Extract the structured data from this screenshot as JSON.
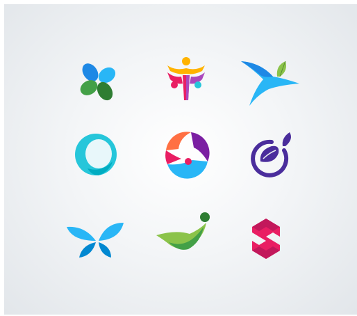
{
  "logos": [
    {
      "name": "clover-propeller-logo",
      "colors": [
        "#1e88e5",
        "#29b6f6",
        "#43a047",
        "#2e7d32"
      ]
    },
    {
      "name": "people-group-logo",
      "colors": [
        "#ffb300",
        "#e91e63",
        "#26c6da",
        "#ab47bc"
      ]
    },
    {
      "name": "bird-leaf-logo",
      "colors": [
        "#1e88e5",
        "#4fc3f7",
        "#8bc34a"
      ]
    },
    {
      "name": "ring-logo",
      "colors": [
        "#26c6da",
        "#00acc1",
        "#80deea"
      ]
    },
    {
      "name": "circle-people-logo",
      "colors": [
        "#ff7043",
        "#7b1fa2",
        "#e91e63",
        "#29b6f6"
      ]
    },
    {
      "name": "seed-leaf-ring-logo",
      "colors": [
        "#4a2d9c",
        "#6a5acd"
      ]
    },
    {
      "name": "butterfly-logo",
      "colors": [
        "#29b6f6",
        "#0288d1"
      ]
    },
    {
      "name": "swoosh-runner-logo",
      "colors": [
        "#8bc34a",
        "#2e7d32",
        "#43a047"
      ]
    },
    {
      "name": "s-hexagon-logo",
      "colors": [
        "#e91e63",
        "#c2185b"
      ]
    }
  ]
}
